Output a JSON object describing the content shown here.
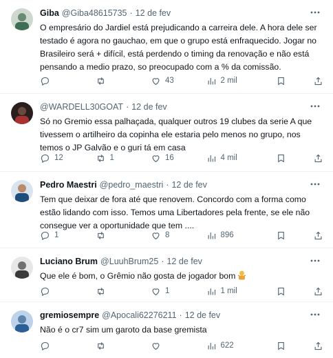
{
  "tweets": [
    {
      "name": "Giba",
      "handle": "@Giba48615735",
      "dot": "·",
      "date": "12 de fev",
      "text": "O empresário do Jardiel está prejudicando a carreira dele. A hora dele ser testado é agora no gauchao, em que o grupo está enfraquecido. Jogar no Brasileiro será + difícil, está perdendo o timing da renovação e não está pensando a medio prazo, so preocupado com a % da comissão.",
      "replies": "",
      "reposts": "",
      "likes": "43",
      "views": "2 mil",
      "avatar_color": "#5a7d6a"
    },
    {
      "name": "",
      "handle": "@WARDELL30GOAT",
      "dot": "·",
      "date": "12 de fev",
      "text": "Só no Gremio essa palhaçada, qualquer outros 19 clubes da serie A que tivessem o artilheiro da copinha ele estaria pelo menos no grupo, nos temos o JP Galvão e o guri tá em casa",
      "replies": "12",
      "reposts": "1",
      "likes": "16",
      "views": "4 mil",
      "avatar_color": "#3b2a2a"
    },
    {
      "name": "Pedro Maestri",
      "handle": "@pedro_maestri",
      "dot": "·",
      "date": "12 de fev",
      "text": "Tem que deixar de fora até que renovem. Concordo com a forma como estão lidando com isso. Temos uma Libertadores pela frente, se ele não consegue ver a oportunidade que tem ....",
      "replies": "1",
      "reposts": "",
      "likes": "8",
      "views": "896",
      "avatar_color": "#2f5f8a"
    },
    {
      "name": "Luciano Brum",
      "handle": "@LuuhBrum25",
      "dot": "·",
      "date": "12 de fev",
      "text": "Que ele é bom, o Grêmio não gosta de jogador bom",
      "replies": "",
      "reposts": "",
      "likes": "1",
      "views": "1 mil",
      "avatar_color": "#8a8a8a"
    },
    {
      "name": "gremiosempre",
      "handle": "@Apocali62276211",
      "dot": "·",
      "date": "12 de fev",
      "text": "Não é o cr7 sim um garoto da base gremista",
      "replies": "",
      "reposts": "",
      "likes": "",
      "views": "622",
      "avatar_color": "#4f7fb0"
    }
  ]
}
